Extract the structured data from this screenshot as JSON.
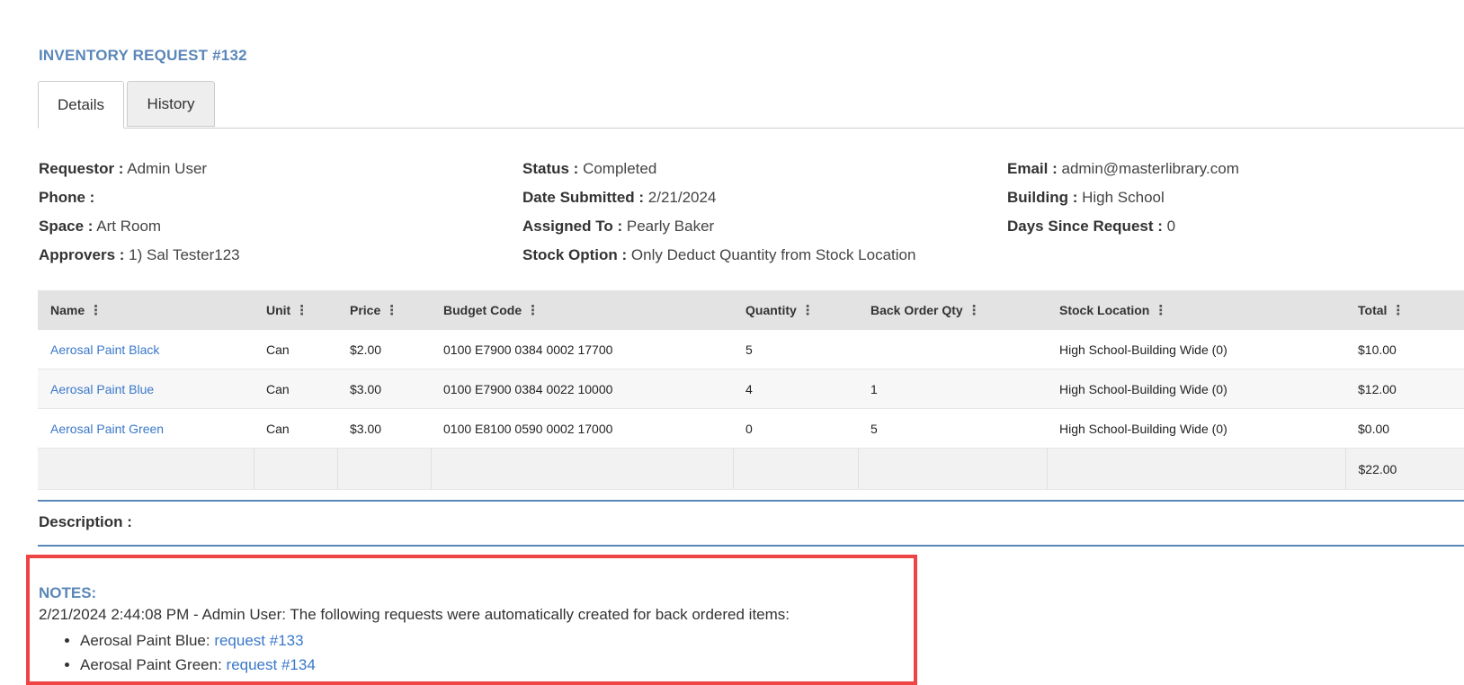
{
  "header": {
    "title": "INVENTORY REQUEST #132"
  },
  "tabs": [
    {
      "label": "Details",
      "active": true
    },
    {
      "label": "History",
      "active": false
    }
  ],
  "details": {
    "requestor": {
      "label": "Requestor :",
      "value": "Admin User"
    },
    "phone": {
      "label": "Phone :",
      "value": ""
    },
    "space": {
      "label": "Space :",
      "value": "Art Room"
    },
    "approvers": {
      "label": "Approvers :",
      "value": "1) Sal Tester123"
    },
    "status": {
      "label": "Status :",
      "value": "Completed"
    },
    "date_submitted": {
      "label": "Date Submitted :",
      "value": "2/21/2024"
    },
    "assigned_to": {
      "label": "Assigned To :",
      "value": "Pearly Baker"
    },
    "stock_option": {
      "label": "Stock Option :",
      "value": "Only Deduct Quantity from Stock Location"
    },
    "email": {
      "label": "Email :",
      "value": "admin@masterlibrary.com"
    },
    "building": {
      "label": "Building :",
      "value": "High School"
    },
    "days_since": {
      "label": "Days Since Request :",
      "value": "0"
    }
  },
  "table": {
    "columns": [
      "Name",
      "Unit",
      "Price",
      "Budget Code",
      "Quantity",
      "Back Order Qty",
      "Stock Location",
      "Total"
    ],
    "rows": [
      {
        "name": "Aerosal Paint Black",
        "unit": "Can",
        "price": "$2.00",
        "budget_code": "0100 E7900 0384 0002 17700",
        "quantity": "5",
        "back_order_qty": "",
        "stock_location": "High School-Building Wide (0)",
        "total": "$10.00"
      },
      {
        "name": "Aerosal Paint Blue",
        "unit": "Can",
        "price": "$3.00",
        "budget_code": "0100 E7900 0384 0022 10000",
        "quantity": "4",
        "back_order_qty": "1",
        "stock_location": "High School-Building Wide (0)",
        "total": "$12.00"
      },
      {
        "name": "Aerosal Paint Green",
        "unit": "Can",
        "price": "$3.00",
        "budget_code": "0100 E8100 0590 0002 17000",
        "quantity": "0",
        "back_order_qty": "5",
        "stock_location": "High School-Building Wide (0)",
        "total": "$0.00"
      }
    ],
    "grand_total": "$22.00"
  },
  "description": {
    "label": "Description :"
  },
  "notes": {
    "title": "NOTES:",
    "entry": "2/21/2024 2:44:08 PM - Admin User: The following requests were automatically created for back ordered items:",
    "items": [
      {
        "label": "Aerosal Paint Blue: ",
        "link": "request #133"
      },
      {
        "label": "Aerosal Paint Green: ",
        "link": "request #134"
      }
    ]
  },
  "icons": {
    "column_menu": "kebab-menu-icon"
  },
  "colors": {
    "accent": "#5b87b8",
    "link": "#3a78c9",
    "highlight_border": "#ee4444"
  }
}
